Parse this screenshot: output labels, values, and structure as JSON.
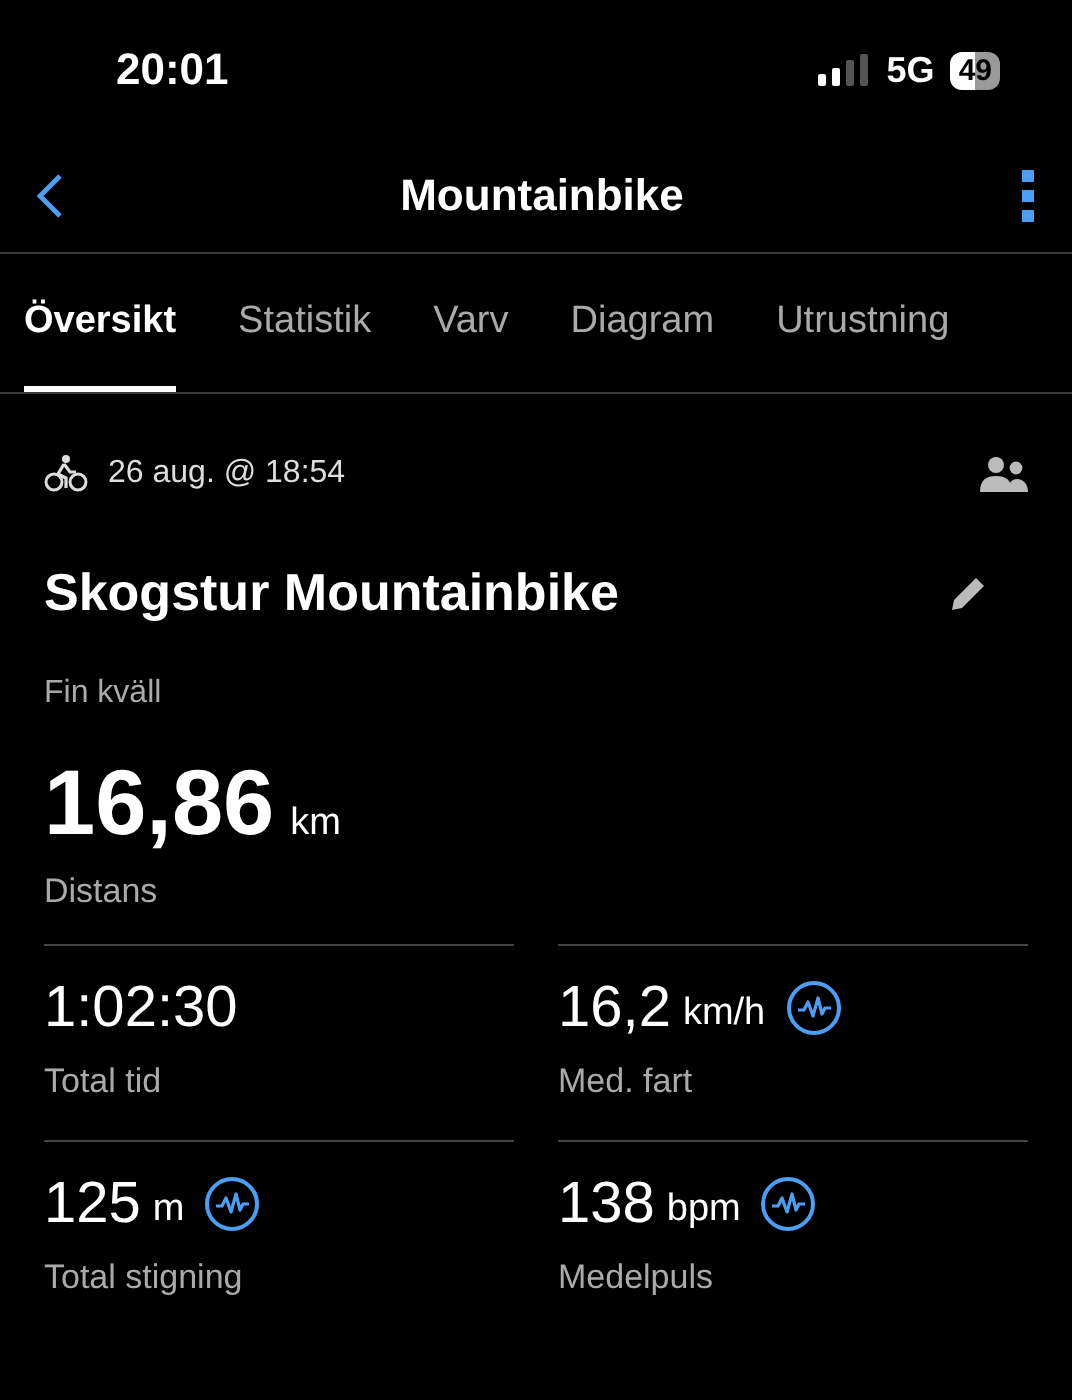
{
  "status_bar": {
    "time": "20:01",
    "network": "5G",
    "battery": "49"
  },
  "nav": {
    "title": "Mountainbike"
  },
  "tabs": [
    {
      "label": "Översikt",
      "selected": true
    },
    {
      "label": "Statistik",
      "selected": false
    },
    {
      "label": "Varv",
      "selected": false
    },
    {
      "label": "Diagram",
      "selected": false
    },
    {
      "label": "Utrustning",
      "selected": false
    }
  ],
  "activity": {
    "date": "26 aug. @ 18:54",
    "name": "Skogstur Mountainbike",
    "description": "Fin kväll",
    "distance": {
      "value": "16,86",
      "unit": "km",
      "label": "Distans"
    }
  },
  "stats": [
    {
      "value": "1:02:30",
      "label": "Total tid",
      "chart_icon": false
    },
    {
      "value": "16,2",
      "unit": "km/h",
      "label": "Med. fart",
      "chart_icon": true
    },
    {
      "value": "125",
      "unit": "m",
      "label": "Total stigning",
      "chart_icon": true
    },
    {
      "value": "138",
      "unit": "bpm",
      "label": "Medelpuls",
      "chart_icon": true
    }
  ]
}
